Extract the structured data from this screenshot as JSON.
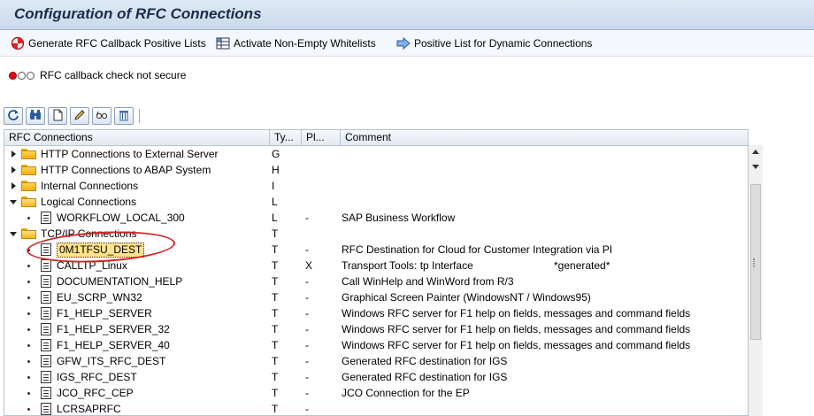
{
  "window": {
    "title": "Configuration of RFC Connections"
  },
  "toolbar": {
    "buttons": [
      {
        "label": "Generate RFC Callback Positive Lists",
        "icon": "generate-icon"
      },
      {
        "label": "Activate Non-Empty Whitelists",
        "icon": "activate-list-icon"
      },
      {
        "label": "Positive List for Dynamic Connections",
        "icon": "arrow-right-icon"
      }
    ]
  },
  "status": {
    "text": "RFC callback check not secure",
    "light": "red"
  },
  "alv_toolbar": {
    "icons": [
      "refresh-icon",
      "find-icon",
      "create-icon",
      "change-icon",
      "test-icon",
      "delete-icon"
    ]
  },
  "tree": {
    "columns": [
      "RFC Connections",
      "Ty...",
      "Pl...",
      "Comment"
    ],
    "rows": [
      {
        "name": "HTTP Connections to External Server",
        "type": "G",
        "pl": "",
        "comment": "",
        "kind": "folder",
        "expanded": false
      },
      {
        "name": "HTTP Connections to ABAP System",
        "type": "H",
        "pl": "",
        "comment": "",
        "kind": "folder",
        "expanded": false
      },
      {
        "name": "Internal Connections",
        "type": "I",
        "pl": "",
        "comment": "",
        "kind": "folder",
        "expanded": false
      },
      {
        "name": "Logical Connections",
        "type": "L",
        "pl": "",
        "comment": "",
        "kind": "folder",
        "expanded": true
      },
      {
        "name": "WORKFLOW_LOCAL_300",
        "type": "L",
        "pl": "-",
        "comment": "SAP Business Workflow",
        "kind": "item"
      },
      {
        "name": "TCP/IP Connections",
        "type": "T",
        "pl": "",
        "comment": "",
        "kind": "folder",
        "expanded": true
      },
      {
        "name": "0M1TFSU_DEST",
        "type": "T",
        "pl": "-",
        "comment": "RFC Destination for Cloud for Customer Integration via PI",
        "kind": "item",
        "selected": true
      },
      {
        "name": "CALLTP_Linux",
        "type": "T",
        "pl": "X",
        "comment": "Transport Tools: tp Interface",
        "comment2": "*generated*",
        "kind": "item"
      },
      {
        "name": "DOCUMENTATION_HELP",
        "type": "T",
        "pl": "-",
        "comment": "Call WinHelp and WinWord from R/3",
        "kind": "item"
      },
      {
        "name": "EU_SCRP_WN32",
        "type": "T",
        "pl": "-",
        "comment": "Graphical Screen Painter (WindowsNT / Windows95)",
        "kind": "item"
      },
      {
        "name": "F1_HELP_SERVER",
        "type": "T",
        "pl": "-",
        "comment": "Windows RFC server for F1 help on fields, messages and command fields",
        "kind": "item"
      },
      {
        "name": "F1_HELP_SERVER_32",
        "type": "T",
        "pl": "-",
        "comment": "Windows RFC server for F1 help on fields, messages and command fields",
        "kind": "item"
      },
      {
        "name": "F1_HELP_SERVER_40",
        "type": "T",
        "pl": "-",
        "comment": "Windows RFC server for F1 help on fields, messages and command fields",
        "kind": "item"
      },
      {
        "name": "GFW_ITS_RFC_DEST",
        "type": "T",
        "pl": "-",
        "comment": "Generated RFC destination for IGS",
        "kind": "item"
      },
      {
        "name": "IGS_RFC_DEST",
        "type": "T",
        "pl": "-",
        "comment": "Generated RFC destination for IGS",
        "kind": "item"
      },
      {
        "name": "JCO_RFC_CEP",
        "type": "T",
        "pl": "-",
        "comment": "JCO Connection for the EP",
        "kind": "item"
      },
      {
        "name": "LCRSAPRFC",
        "type": "T",
        "pl": "-",
        "comment": "",
        "kind": "item"
      }
    ]
  },
  "colors": {
    "title_bg": "#c9d9ec",
    "highlight": "#ffe28a",
    "annotation": "#d62020",
    "folder": "#f2ad16"
  }
}
